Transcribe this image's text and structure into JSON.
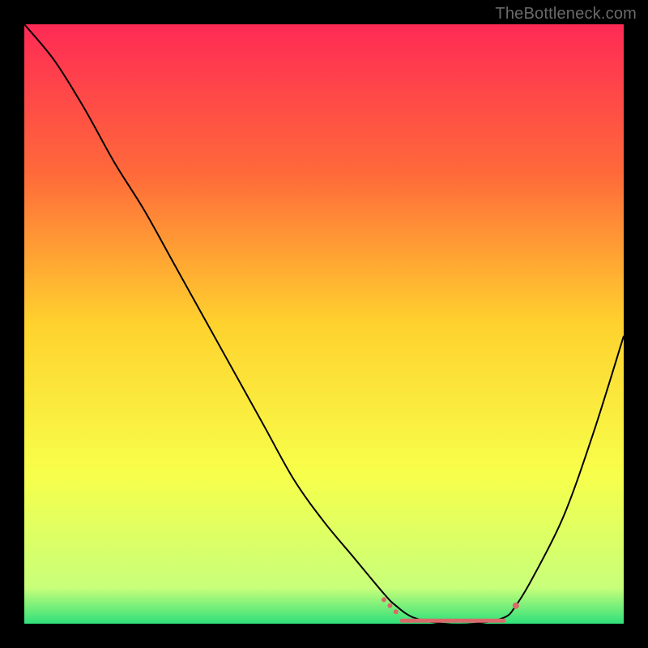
{
  "watermark": "TheBottleneck.com",
  "chart_data": {
    "type": "line",
    "title": "",
    "xlabel": "",
    "ylabel": "",
    "xlim": [
      0,
      100
    ],
    "ylim": [
      0,
      100
    ],
    "background": {
      "type": "vertical-gradient",
      "stops": [
        {
          "offset": 0,
          "color": "#ff2a55"
        },
        {
          "offset": 25,
          "color": "#ff6a3a"
        },
        {
          "offset": 50,
          "color": "#ffd22e"
        },
        {
          "offset": 75,
          "color": "#f7ff4a"
        },
        {
          "offset": 94,
          "color": "#c8ff7a"
        },
        {
          "offset": 100,
          "color": "#2fe07a"
        }
      ]
    },
    "series": [
      {
        "name": "bottleneck-curve",
        "color": "#000000",
        "x": [
          0,
          5,
          10,
          15,
          20,
          25,
          30,
          35,
          40,
          45,
          50,
          55,
          60,
          62,
          65,
          70,
          75,
          80,
          82,
          85,
          90,
          95,
          100
        ],
        "y": [
          100,
          94,
          86,
          77,
          69,
          60,
          51,
          42,
          33,
          24,
          17,
          11,
          5,
          3,
          1,
          0,
          0,
          1,
          3,
          8,
          18,
          32,
          48
        ]
      }
    ],
    "markers": [
      {
        "x": 60,
        "y": 4,
        "color": "#d86a6a",
        "r": 3
      },
      {
        "x": 61,
        "y": 3,
        "color": "#d86a6a",
        "r": 3
      },
      {
        "x": 62,
        "y": 2,
        "color": "#d86a6a",
        "r": 3
      },
      {
        "x": 82,
        "y": 3,
        "color": "#d86a6a",
        "r": 4
      }
    ],
    "flat_zone": {
      "x_start": 63,
      "x_end": 80,
      "y": 0.5,
      "color": "#d86a6a",
      "thickness": 5
    }
  }
}
